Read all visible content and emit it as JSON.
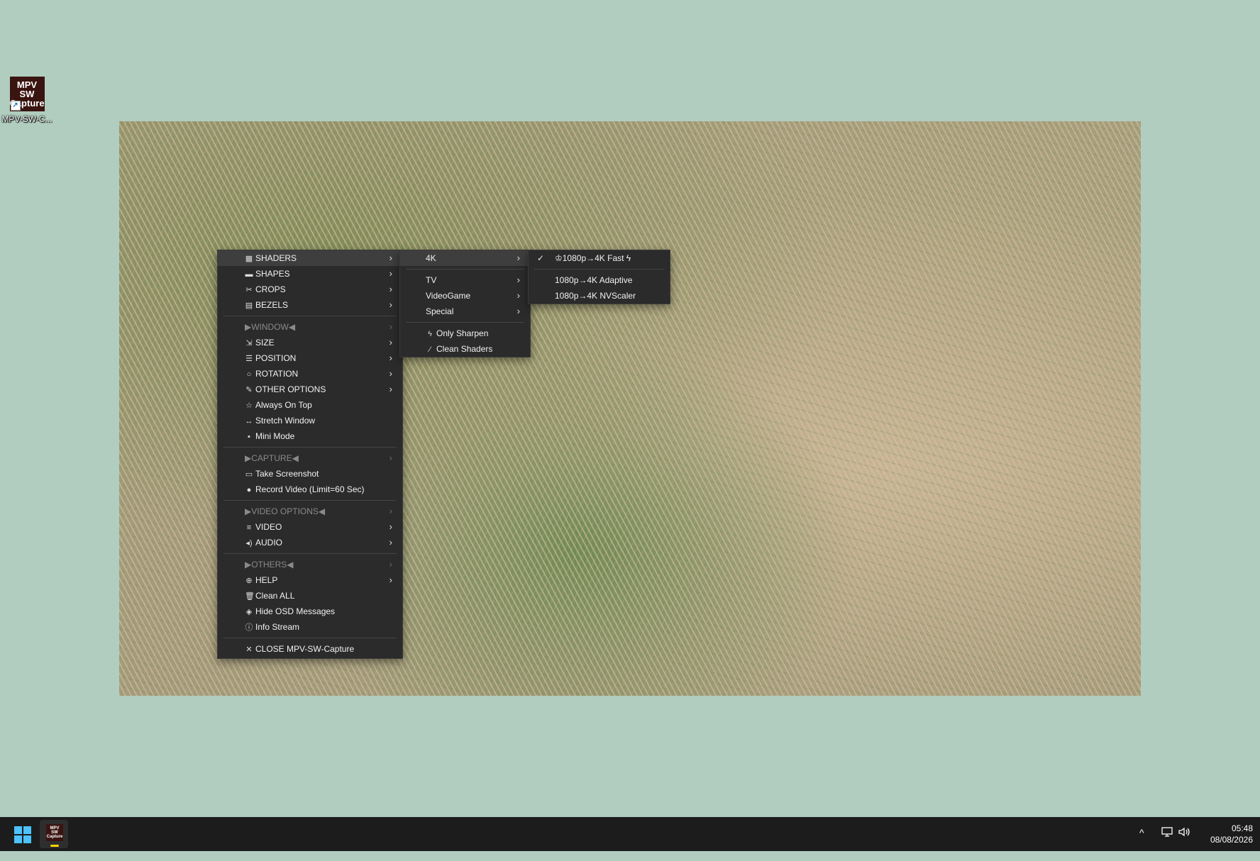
{
  "desktop": {
    "icon": {
      "logo_lines": [
        "MPV",
        "SW",
        "Capture"
      ],
      "caption": "MPV-SW-C..."
    }
  },
  "menu_main": {
    "items": [
      {
        "icon": "▦",
        "label": "SHADERS",
        "submenu": true
      },
      {
        "icon": "▬",
        "label": "SHAPES",
        "submenu": true
      },
      {
        "icon": "✂",
        "label": "CROPS",
        "submenu": true
      },
      {
        "icon": "▤",
        "label": "BEZELS",
        "submenu": true
      },
      {
        "label": "▶WINDOW◀",
        "header": true
      },
      {
        "icon": "⇲",
        "label": "SIZE",
        "submenu": true
      },
      {
        "icon": "☰",
        "label": "POSITION",
        "submenu": true
      },
      {
        "icon": "○",
        "label": "ROTATION",
        "submenu": true
      },
      {
        "icon": "✎",
        "label": "OTHER OPTIONS",
        "submenu": true
      },
      {
        "icon": "☆",
        "label": "Always On Top"
      },
      {
        "icon": "↔",
        "label": "Stretch Window"
      },
      {
        "icon": "▪",
        "label": "Mini Mode"
      },
      {
        "label": "▶CAPTURE◀",
        "header": true
      },
      {
        "icon": "▭",
        "label": "Take Screenshot"
      },
      {
        "icon": "●",
        "label": "Record Video (Limit=60 Sec)"
      },
      {
        "label": "▶VIDEO OPTIONS◀",
        "header": true
      },
      {
        "icon": "≡",
        "label": "VIDEO",
        "submenu": true
      },
      {
        "icon": "◂)",
        "label": "AUDIO",
        "submenu": true
      },
      {
        "label": "▶OTHERS◀",
        "header": true
      },
      {
        "icon": "⊕",
        "label": "HELP",
        "submenu": true
      },
      {
        "icon": "🗑",
        "label": "Clean ALL"
      },
      {
        "icon": "◈",
        "label": "Hide OSD Messages"
      },
      {
        "icon": "ⓘ",
        "label": "Info Stream"
      },
      {
        "icon": "✕",
        "label": "CLOSE MPV-SW-Capture"
      }
    ]
  },
  "menu_shaders": {
    "items": [
      {
        "label": "4K",
        "submenu": true
      },
      {
        "label": "TV",
        "submenu": true
      },
      {
        "label": "VideoGame",
        "submenu": true
      },
      {
        "label": "Special",
        "submenu": true
      },
      {
        "icon": "ϟ",
        "label": "Only Sharpen"
      },
      {
        "icon": "⁄",
        "label": "Clean Shaders"
      }
    ]
  },
  "menu_4k": {
    "items": [
      {
        "label": "♔1080p→4K Fast ϟ",
        "checked": true
      },
      {
        "label": "1080p→4K Adaptive"
      },
      {
        "label": "1080p→4K NVScaler"
      }
    ]
  },
  "taskbar": {
    "app_logo_lines": [
      "MPV",
      "SW",
      "Capture"
    ],
    "tray_overflow": "^",
    "time": "05:48",
    "date": "08/08/2026"
  }
}
